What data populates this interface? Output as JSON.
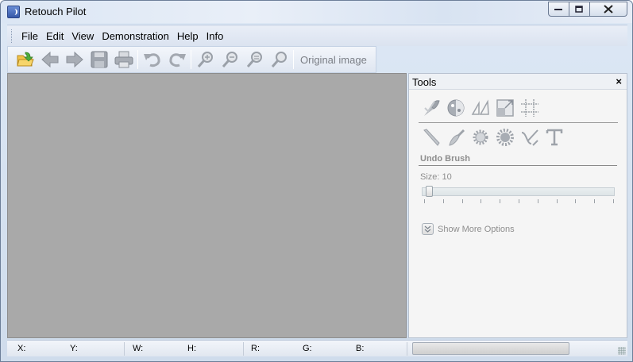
{
  "window": {
    "title": "Retouch Pilot",
    "controls": {
      "minimize": "—",
      "maximize": "□",
      "close": "✕"
    }
  },
  "menu": {
    "items": [
      "File",
      "Edit",
      "View",
      "Demonstration",
      "Help",
      "Info"
    ]
  },
  "toolbar": {
    "buttons": [
      {
        "name": "open-icon",
        "enabled": true
      },
      {
        "name": "back-icon",
        "enabled": false
      },
      {
        "name": "forward-icon",
        "enabled": false
      },
      {
        "name": "save-icon",
        "enabled": false
      },
      {
        "name": "print-icon",
        "enabled": false
      },
      {
        "name": "undo-icon",
        "enabled": false
      },
      {
        "name": "redo-icon",
        "enabled": false
      },
      {
        "name": "zoom-in-icon",
        "enabled": false
      },
      {
        "name": "zoom-out-icon",
        "enabled": false
      },
      {
        "name": "zoom-fit-icon",
        "enabled": false
      },
      {
        "name": "zoom-actual-icon",
        "enabled": false
      }
    ],
    "original_image_label": "Original image"
  },
  "tools_panel": {
    "title": "Tools",
    "close_label": "×",
    "row1_icons": [
      "brush-check-icon",
      "filter-circle-icon",
      "triangle-transform-icon",
      "resize-square-icon",
      "grid-crop-icon"
    ],
    "row2_icons": [
      "pencil-icon",
      "paint-brush-icon",
      "gear-stamp-icon",
      "gear-fill-icon",
      "curve-tool-icon",
      "text-tool-icon"
    ],
    "section_title": "Undo Brush",
    "size_label": "Size:",
    "size_value": "10",
    "slider_fraction": 0.02,
    "more_options_label": "Show More Options"
  },
  "status": {
    "x_label": "X:",
    "y_label": "Y:",
    "w_label": "W:",
    "h_label": "H:",
    "r_label": "R:",
    "g_label": "G:",
    "b_label": "B:"
  },
  "colors": {
    "canvas": "#a9a9a9",
    "accent_orange": "#e8a33a",
    "accent_green": "#5bb04a",
    "disabled_gray": "#9aa0a8"
  }
}
